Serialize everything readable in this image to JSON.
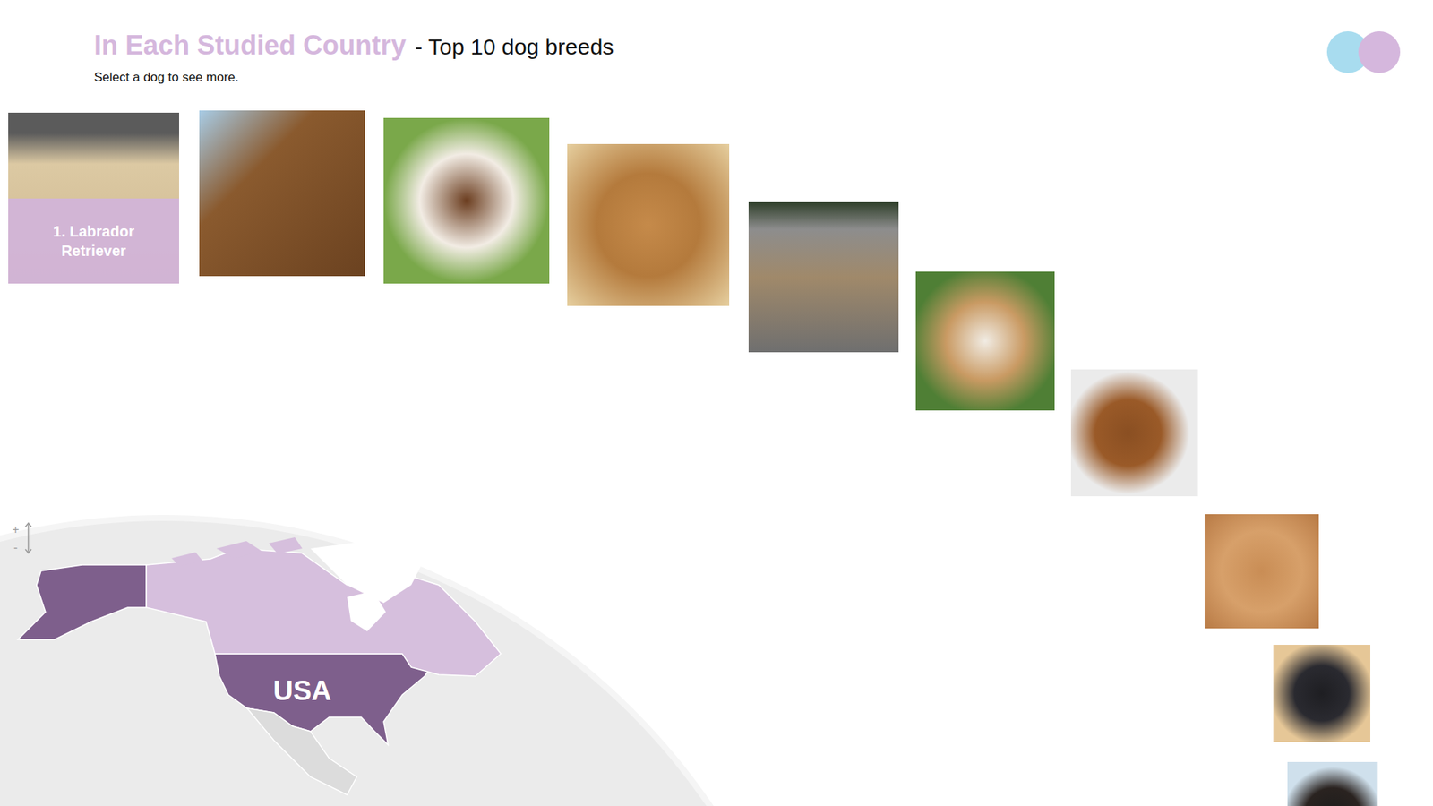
{
  "header": {
    "title": "In Each Studied Country",
    "subtitle": "- Top 10 dog breeds",
    "hint": "Select a dog to see more."
  },
  "dogs": [
    {
      "label": "1. Labrador Retriever",
      "selected": true
    },
    {
      "selected": false
    },
    {
      "selected": false
    },
    {
      "selected": false
    },
    {
      "selected": false
    },
    {
      "selected": false
    },
    {
      "selected": false
    },
    {
      "selected": false
    },
    {
      "selected": false
    },
    {
      "selected": false
    }
  ],
  "map": {
    "zoom_in": "+",
    "zoom_out": "-",
    "countries": [
      {
        "label": "USA",
        "selected": true,
        "studied": true
      },
      {
        "selected": false,
        "studied": true
      },
      {
        "selected": false,
        "studied": false
      }
    ]
  }
}
